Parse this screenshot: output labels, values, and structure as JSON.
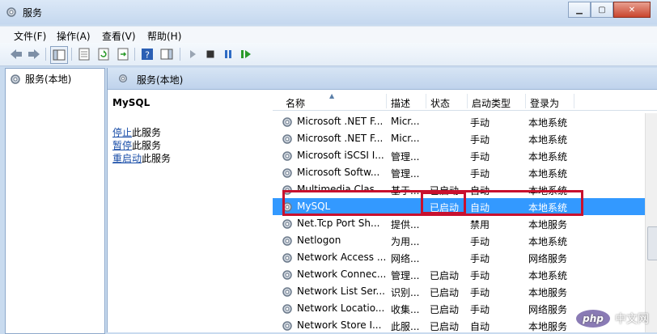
{
  "window": {
    "title": "服务"
  },
  "menu": [
    "文件(F)",
    "操作(A)",
    "查看(V)",
    "帮助(H)"
  ],
  "tree": {
    "item": "服务(本地)"
  },
  "pane": {
    "header": "服务(本地)",
    "selected_service": "MySQL",
    "actions": [
      {
        "link": "停止",
        "rest": "此服务"
      },
      {
        "link": "暂停",
        "rest": "此服务"
      },
      {
        "link": "重启动",
        "rest": "此服务"
      }
    ]
  },
  "table": {
    "columns": [
      "名称",
      "描述",
      "状态",
      "启动类型",
      "登录为"
    ],
    "rows": [
      {
        "name": "Microsoft .NET F...",
        "desc": "Micr...",
        "state": "",
        "start": "手动",
        "logon": "本地系统"
      },
      {
        "name": "Microsoft .NET F...",
        "desc": "Micr...",
        "state": "",
        "start": "手动",
        "logon": "本地系统"
      },
      {
        "name": "Microsoft iSCSI I...",
        "desc": "管理...",
        "state": "",
        "start": "手动",
        "logon": "本地系统"
      },
      {
        "name": "Microsoft Softw...",
        "desc": "管理...",
        "state": "",
        "start": "手动",
        "logon": "本地系统"
      },
      {
        "name": "Multimedia Clas...",
        "desc": "基于...",
        "state": "已启动",
        "start": "自动",
        "logon": "本地系统"
      },
      {
        "name": "MySQL",
        "desc": "",
        "state": "已启动",
        "start": "自动",
        "logon": "本地系统",
        "selected": true
      },
      {
        "name": "Net.Tcp Port Sh...",
        "desc": "提供...",
        "state": "",
        "start": "禁用",
        "logon": "本地服务"
      },
      {
        "name": "Netlogon",
        "desc": "为用...",
        "state": "",
        "start": "手动",
        "logon": "本地系统"
      },
      {
        "name": "Network Access ...",
        "desc": "网络...",
        "state": "",
        "start": "手动",
        "logon": "网络服务"
      },
      {
        "name": "Network Connec...",
        "desc": "管理...",
        "state": "已启动",
        "start": "手动",
        "logon": "本地系统"
      },
      {
        "name": "Network List Ser...",
        "desc": "识别...",
        "state": "已启动",
        "start": "手动",
        "logon": "本地服务"
      },
      {
        "name": "Network Locatio...",
        "desc": "收集...",
        "state": "已启动",
        "start": "手动",
        "logon": "网络服务"
      },
      {
        "name": "Network Store I...",
        "desc": "此服...",
        "state": "已启动",
        "start": "自动",
        "logon": "本地服务"
      }
    ]
  },
  "watermark": {
    "badge": "php",
    "text": "中文网"
  },
  "colors": {
    "selection": "#3399ff",
    "highlight_box": "#c8102e",
    "link": "#1a4ea8"
  }
}
